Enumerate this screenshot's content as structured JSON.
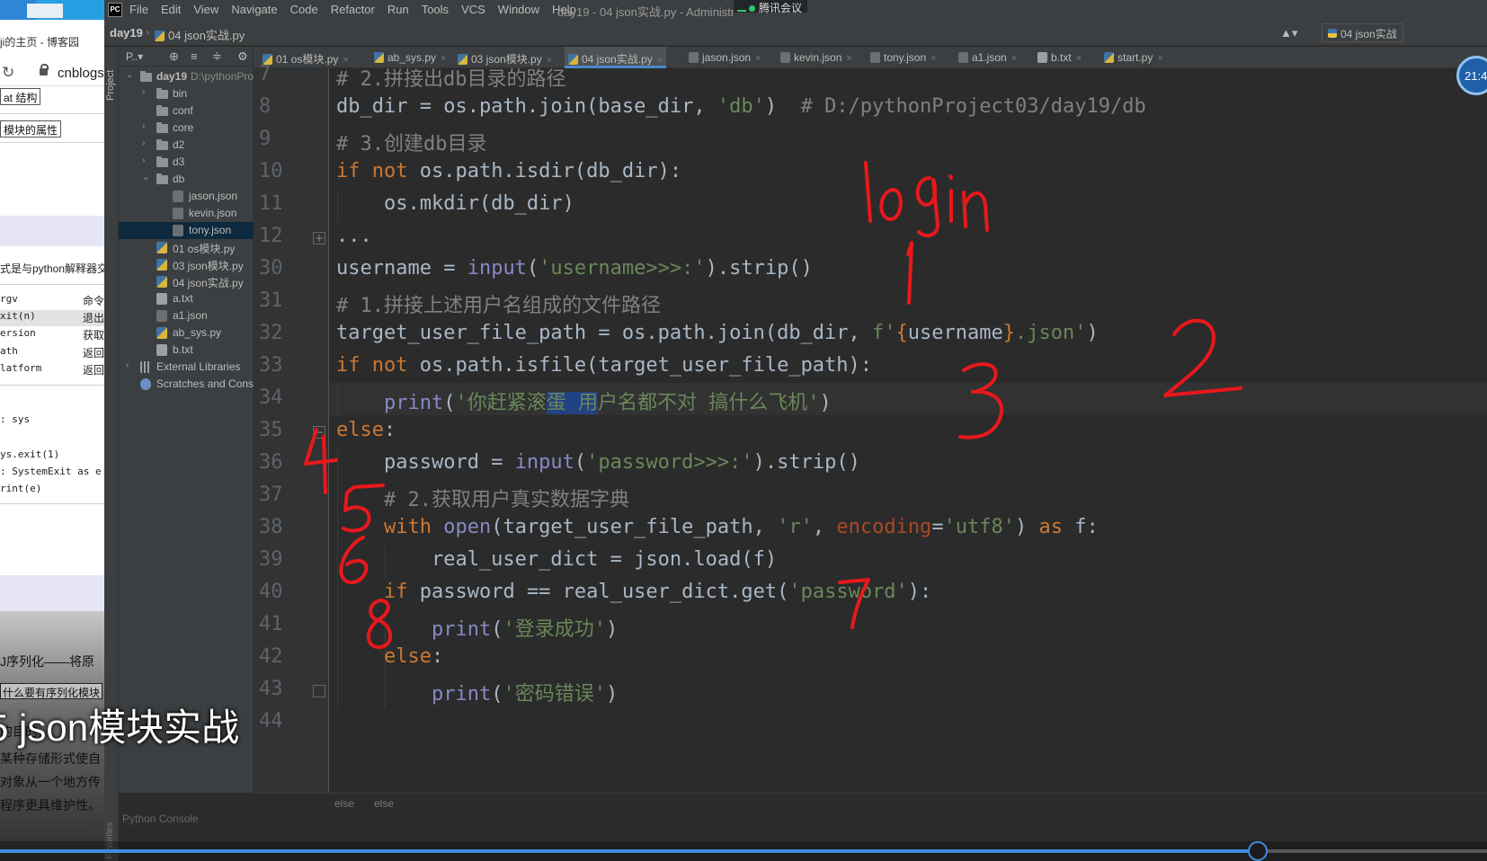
{
  "browser": {
    "tab_title": "ji的主页 - 博客园",
    "url": "cnblogs",
    "box1": "at 结构",
    "box2": "模块的属性",
    "text1": "式是与python解释器交",
    "rows": [
      {
        "code": "rgv",
        "desc": "命令"
      },
      {
        "code": "xit(n)",
        "desc": "退出"
      },
      {
        "code": "ersion",
        "desc": "获取"
      },
      {
        "code": "ath",
        "desc": "返回"
      },
      {
        "code": "latform",
        "desc": "返回"
      }
    ],
    "code_lines": [
      ": sys",
      "ys.exit(1)",
      ": SystemExit as e",
      "rint(e)"
    ],
    "bottom": {
      "t1": "J序列化——将原",
      "box": "什么要有序列化模块",
      "t2": "的目的",
      "t3": "某种存储形式使自",
      "t4": "对象从一个地方传",
      "t5": "程序更具维护性。"
    }
  },
  "menubar": {
    "logo": "PC",
    "items": [
      "File",
      "Edit",
      "View",
      "Navigate",
      "Code",
      "Refactor",
      "Run",
      "Tools",
      "VCS",
      "Window",
      "Help"
    ],
    "window_title": "day19 - 04 json实战.py - Administr",
    "meeting": "腾讯会议"
  },
  "navbar": {
    "project": "day19",
    "file": "04 json实战.py",
    "user_icon": "▲▾",
    "run_config": "04 json实战"
  },
  "side": {
    "project_label": "Project",
    "favorites_label": "Favorites"
  },
  "project_panel": {
    "title": "P..▾",
    "tree": [
      {
        "name": "day19",
        "path": "D:\\pythonPro",
        "icon": "folder",
        "depth": 0,
        "arrow": "⌄",
        "bold": true
      },
      {
        "name": "bin",
        "icon": "folder",
        "depth": 1,
        "arrow": "›"
      },
      {
        "name": "conf",
        "icon": "folder",
        "depth": 1,
        "arrow": ""
      },
      {
        "name": "core",
        "icon": "folder",
        "depth": 1,
        "arrow": "›"
      },
      {
        "name": "d2",
        "icon": "folder",
        "depth": 1,
        "arrow": "›"
      },
      {
        "name": "d3",
        "icon": "folder",
        "depth": 1,
        "arrow": "›"
      },
      {
        "name": "db",
        "icon": "folder",
        "depth": 1,
        "arrow": "⌄"
      },
      {
        "name": "jason.json",
        "icon": "json",
        "depth": 2,
        "arrow": ""
      },
      {
        "name": "kevin.json",
        "icon": "json",
        "depth": 2,
        "arrow": ""
      },
      {
        "name": "tony.json",
        "icon": "json",
        "depth": 2,
        "arrow": "",
        "selected": true
      },
      {
        "name": "01 os模块.py",
        "icon": "py",
        "depth": 1,
        "arrow": ""
      },
      {
        "name": "03 json模块.py",
        "icon": "py",
        "depth": 1,
        "arrow": ""
      },
      {
        "name": "04 json实战.py",
        "icon": "py",
        "depth": 1,
        "arrow": ""
      },
      {
        "name": "a.txt",
        "icon": "txt",
        "depth": 1,
        "arrow": ""
      },
      {
        "name": "a1.json",
        "icon": "json",
        "depth": 1,
        "arrow": ""
      },
      {
        "name": "ab_sys.py",
        "icon": "py",
        "depth": 1,
        "arrow": ""
      },
      {
        "name": "b.txt",
        "icon": "txt",
        "depth": 1,
        "arrow": ""
      },
      {
        "name": "External Libraries",
        "icon": "lib",
        "depth": 0,
        "arrow": "›"
      },
      {
        "name": "Scratches and Cons",
        "icon": "scr",
        "depth": 0,
        "arrow": ""
      }
    ]
  },
  "tabs": [
    {
      "label": "01 os模块.py",
      "icon": "py"
    },
    {
      "label": "ab_sys.py",
      "icon": "py"
    },
    {
      "label": "03 json模块.py",
      "icon": "py"
    },
    {
      "label": "04 json实战.py",
      "icon": "py",
      "active": true
    },
    {
      "label": "jason.json",
      "icon": "json"
    },
    {
      "label": "kevin.json",
      "icon": "json"
    },
    {
      "label": "tony.json",
      "icon": "json"
    },
    {
      "label": "a1.json",
      "icon": "json"
    },
    {
      "label": "b.txt",
      "icon": "txt"
    },
    {
      "label": "start.py",
      "icon": "py"
    }
  ],
  "editor": {
    "line_numbers": [
      "7",
      "8",
      "9",
      "10",
      "11",
      "12",
      "30",
      "31",
      "32",
      "33",
      "34",
      "35",
      "36",
      "37",
      "38",
      "39",
      "40",
      "41",
      "42",
      "43",
      "44"
    ],
    "lines": [
      [
        {
          "t": "# 2.拼接出db目录的路径",
          "c": "cm"
        }
      ],
      [
        {
          "t": "db_dir = os.path.join(base_dir, "
        },
        {
          "t": "'db'",
          "c": "str"
        },
        {
          "t": ")  "
        },
        {
          "t": "# D:/pythonProject03/day19/db",
          "c": "cm"
        }
      ],
      [
        {
          "t": "# 3.创建db目录",
          "c": "cm"
        }
      ],
      [
        {
          "t": "if not ",
          "c": "kw"
        },
        {
          "t": "os.path.isdir(db_dir):"
        }
      ],
      [
        {
          "t": "    os.mkdir(db_dir)"
        }
      ],
      [
        {
          "t": "..."
        }
      ],
      [
        {
          "t": "username = "
        },
        {
          "t": "input",
          "c": "bi"
        },
        {
          "t": "("
        },
        {
          "t": "'username>>>:'",
          "c": "str"
        },
        {
          "t": ").strip()"
        }
      ],
      [
        {
          "t": "# 1.拼接上述用户名组成的文件路径",
          "c": "cm"
        }
      ],
      [
        {
          "t": "target_user_file_path = os.path.join(db_dir, "
        },
        {
          "t": "f'",
          "c": "str"
        },
        {
          "t": "{",
          "c": "fmt"
        },
        {
          "t": "username"
        },
        {
          "t": "}",
          "c": "fmt"
        },
        {
          "t": ".json'",
          "c": "str"
        },
        {
          "t": ")"
        }
      ],
      [
        {
          "t": "if not ",
          "c": "kw"
        },
        {
          "t": "os.path.isfile(target_user_file_path):"
        }
      ],
      [
        {
          "t": "    "
        },
        {
          "t": "print",
          "c": "bi"
        },
        {
          "t": "("
        },
        {
          "t": "'你赶紧滚",
          "c": "str"
        },
        {
          "t": "蛋 用",
          "c": "str sel"
        },
        {
          "t": "户名都不对 搞什么飞机'",
          "c": "str"
        },
        {
          "t": ")"
        }
      ],
      [
        {
          "t": "else",
          "c": "kw"
        },
        {
          "t": ":"
        }
      ],
      [
        {
          "t": "    password = "
        },
        {
          "t": "input",
          "c": "bi"
        },
        {
          "t": "("
        },
        {
          "t": "'password>>>:'",
          "c": "str"
        },
        {
          "t": ").strip()"
        }
      ],
      [
        {
          "t": "    # 2.获取用户真实数据字典",
          "c": "cm"
        }
      ],
      [
        {
          "t": "    "
        },
        {
          "t": "with ",
          "c": "kw"
        },
        {
          "t": "open",
          "c": "bi"
        },
        {
          "t": "(target_user_file_path, "
        },
        {
          "t": "'r'",
          "c": "str"
        },
        {
          "t": ", "
        },
        {
          "t": "encoding",
          "c": "param"
        },
        {
          "t": "="
        },
        {
          "t": "'utf8'",
          "c": "str"
        },
        {
          "t": ") "
        },
        {
          "t": "as ",
          "c": "kw"
        },
        {
          "t": "f:"
        }
      ],
      [
        {
          "t": "        real_user_dict = json.load(f)"
        }
      ],
      [
        {
          "t": "    "
        },
        {
          "t": "if ",
          "c": "kw"
        },
        {
          "t": "password == real_user_dict.get("
        },
        {
          "t": "'password'",
          "c": "str"
        },
        {
          "t": "):"
        }
      ],
      [
        {
          "t": "        "
        },
        {
          "t": "print",
          "c": "bi"
        },
        {
          "t": "("
        },
        {
          "t": "'登录成功'",
          "c": "str"
        },
        {
          "t": ")"
        }
      ],
      [
        {
          "t": "    "
        },
        {
          "t": "else",
          "c": "kw"
        },
        {
          "t": ":"
        }
      ],
      [
        {
          "t": "        "
        },
        {
          "t": "print",
          "c": "bi"
        },
        {
          "t": "("
        },
        {
          "t": "'密码错误'",
          "c": "str"
        },
        {
          "t": ")"
        }
      ],
      []
    ]
  },
  "annotations": [
    "login",
    "1",
    "2",
    "3",
    "4",
    "5",
    "6",
    "7",
    "8"
  ],
  "statusbar": {
    "crumb1": "else",
    "crumb2": "else",
    "console": "Python Console"
  },
  "clock": "21:4",
  "subtitle": "5 json模块实战",
  "video_progress": 0.846,
  "colors": {
    "keyword": "#cc7832",
    "string": "#6a8759",
    "comment": "#808080",
    "builtin": "#8888c6",
    "annotation": "#e8181c",
    "selection": "#214283"
  }
}
